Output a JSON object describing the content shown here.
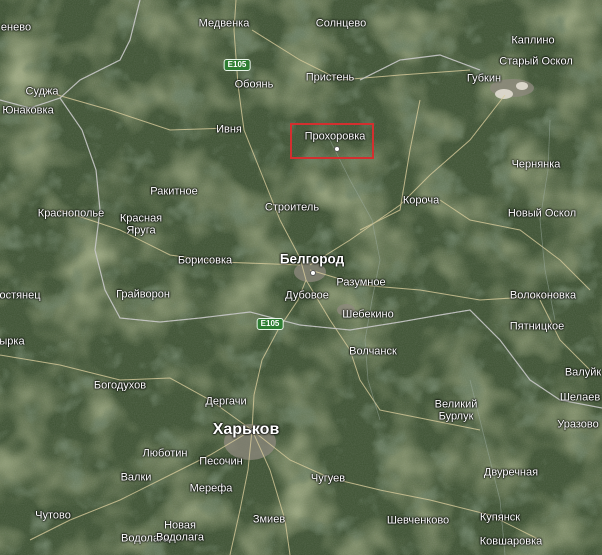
{
  "map": {
    "colors": {
      "terrain": "#3d5232",
      "field": "#6b7a45",
      "forest": "#26361f",
      "urban": "#8f8a7f",
      "road": "#d9cc9c",
      "border": "#c9c9c9",
      "highlight": "#d32f2f",
      "highway_shield": "#2e7d32"
    },
    "highway_label": "E105",
    "highlighted_place": "Прохоровка",
    "places": [
      {
        "id": "medvenka",
        "name": "Медвенка",
        "size": "small"
      },
      {
        "id": "solntsevo",
        "name": "Солнцево",
        "size": "small"
      },
      {
        "id": "kaplino",
        "name": "Каплино",
        "size": "small"
      },
      {
        "id": "stary-oskol",
        "name": "Старый Оскол",
        "size": "medium"
      },
      {
        "id": "gubkin",
        "name": "Губкин",
        "size": "medium"
      },
      {
        "id": "suja",
        "name": "Суджа",
        "size": "small"
      },
      {
        "id": "yunakovka",
        "name": "Юнаковка",
        "size": "small"
      },
      {
        "id": "neevo",
        "name": "енево",
        "size": "small"
      },
      {
        "id": "oboyan",
        "name": "Обоянь",
        "size": "small"
      },
      {
        "id": "pristen",
        "name": "Пристень",
        "size": "small"
      },
      {
        "id": "ivnya",
        "name": "Ивня",
        "size": "small"
      },
      {
        "id": "prokhorovka",
        "name": "Прохоровка",
        "size": "small"
      },
      {
        "id": "chernyanka",
        "name": "Чернянка",
        "size": "small"
      },
      {
        "id": "rakitnoe",
        "name": "Ракитное",
        "size": "small"
      },
      {
        "id": "korocha",
        "name": "Короча",
        "size": "small"
      },
      {
        "id": "krasnopolye",
        "name": "Краснополье",
        "size": "small"
      },
      {
        "id": "stroitel",
        "name": "Строитель",
        "size": "small"
      },
      {
        "id": "novy-oskol",
        "name": "Новый Оскол",
        "size": "small"
      },
      {
        "id": "krasnaya-yaruga",
        "name": "Красная\nЯруга",
        "size": "small"
      },
      {
        "id": "borisovka",
        "name": "Борисовка",
        "size": "small"
      },
      {
        "id": "belgorod",
        "name": "Белгород",
        "size": "large"
      },
      {
        "id": "razumnoe",
        "name": "Разумное",
        "size": "small"
      },
      {
        "id": "ostrets",
        "name": "остянец",
        "size": "small"
      },
      {
        "id": "grayvoron",
        "name": "Грайворон",
        "size": "small"
      },
      {
        "id": "dubovoe",
        "name": "Дубовое",
        "size": "small"
      },
      {
        "id": "volokonovka",
        "name": "Волоконовка",
        "size": "small"
      },
      {
        "id": "shebekino",
        "name": "Шебекино",
        "size": "small"
      },
      {
        "id": "pyatnitskoe",
        "name": "Пятницкое",
        "size": "small"
      },
      {
        "id": "vyrka",
        "name": "ырка",
        "size": "small"
      },
      {
        "id": "volchansk",
        "name": "Волчанск",
        "size": "small"
      },
      {
        "id": "valuyki",
        "name": "Валуйк",
        "size": "small"
      },
      {
        "id": "bogodukhov",
        "name": "Богодухов",
        "size": "small"
      },
      {
        "id": "shelaev",
        "name": "Шелаев",
        "size": "small"
      },
      {
        "id": "dergachi",
        "name": "Дергачи",
        "size": "small"
      },
      {
        "id": "veliky-burluk",
        "name": "Великий\nБурлук",
        "size": "small"
      },
      {
        "id": "kharkov",
        "name": "Харьков",
        "size": "huge"
      },
      {
        "id": "urazovo",
        "name": "Уразово",
        "size": "small"
      },
      {
        "id": "lyubotin",
        "name": "Люботин",
        "size": "small"
      },
      {
        "id": "pesochin",
        "name": "Песочин",
        "size": "small"
      },
      {
        "id": "dvurechnaya",
        "name": "Двуречная",
        "size": "small"
      },
      {
        "id": "valki",
        "name": "Валки",
        "size": "small"
      },
      {
        "id": "chuguev",
        "name": "Чугуев",
        "size": "small"
      },
      {
        "id": "vodolaga",
        "name": "Водолага",
        "size": "small"
      },
      {
        "id": "merefa",
        "name": "Мерефа",
        "size": "small"
      },
      {
        "id": "chutovo",
        "name": "Чутово",
        "size": "small"
      },
      {
        "id": "zmiev",
        "name": "Змиев",
        "size": "small"
      },
      {
        "id": "shevchenkovo",
        "name": "Шевченково",
        "size": "small"
      },
      {
        "id": "kupyansk",
        "name": "Купянск",
        "size": "small"
      },
      {
        "id": "novaya-vodolaga",
        "name": "Новая\nВодолага",
        "size": "small"
      },
      {
        "id": "kovsharovka",
        "name": "Ковшаровка",
        "size": "small"
      }
    ]
  }
}
